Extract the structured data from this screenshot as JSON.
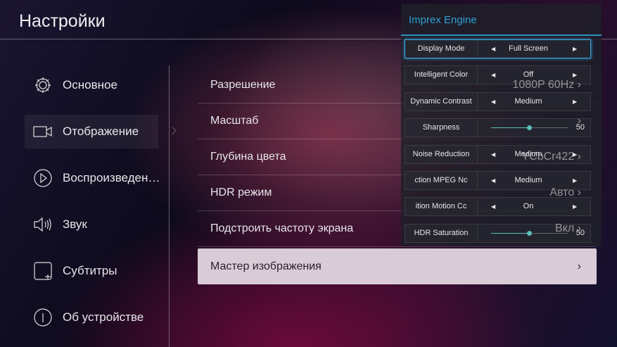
{
  "header": {
    "title": "Настройки"
  },
  "sidebar": {
    "items": [
      {
        "label": "Основное",
        "icon": "gear-icon"
      },
      {
        "label": "Отображение",
        "icon": "video-camera-icon",
        "selected": true
      },
      {
        "label": "Воспроизведен…",
        "icon": "play-circle-icon"
      },
      {
        "label": "Звук",
        "icon": "speaker-icon"
      },
      {
        "label": "Субтитры",
        "icon": "subtitles-icon"
      },
      {
        "label": "Об устройстве",
        "icon": "info-icon"
      }
    ]
  },
  "main": {
    "rows": [
      {
        "label": "Разрешение",
        "value": "1080P 60Hz ›"
      },
      {
        "label": "Масштаб",
        "value": "›"
      },
      {
        "label": "Глубина цвета",
        "value": "YCbCr422 ›"
      },
      {
        "label": "HDR режим",
        "value": "Авто ›"
      },
      {
        "label": "Подстроить частоту экрана",
        "value": "Вкл ›"
      },
      {
        "label": "Мастер изображения",
        "value": "›",
        "selected": true
      }
    ]
  },
  "panel": {
    "title": "Imprex Engine",
    "rows": [
      {
        "label": "Display Mode",
        "value": "Full Screen"
      },
      {
        "label": "Intelligent Color",
        "value": "Off"
      },
      {
        "label": "Dynamic Contrast",
        "value": "Medium"
      },
      {
        "label": "Sharpness",
        "slider": 0.5,
        "value": "50"
      },
      {
        "label": "Noise Reduction",
        "value": "Medium"
      },
      {
        "label": "ction      MPEG Nc",
        "value": "Medium"
      },
      {
        "label": "ition      Motion Cc",
        "value": "On"
      },
      {
        "label": "HDR Saturation",
        "slider": 0.5,
        "value": "50"
      }
    ],
    "left_arrow": "◀",
    "right_arrow": "▶"
  }
}
